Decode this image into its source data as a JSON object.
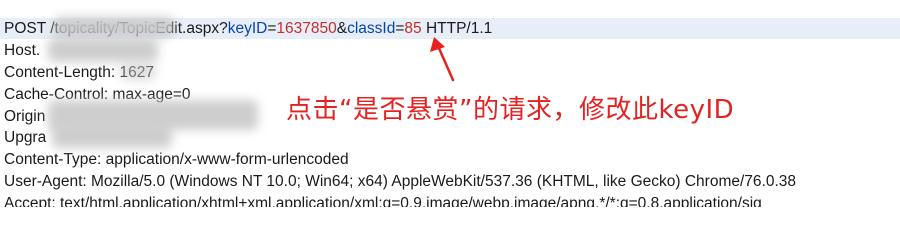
{
  "request": {
    "method": "POST",
    "path_visible": "/topicality/TopicEdit.aspx?",
    "key_param": "keyID",
    "key_eq": "=",
    "key_value": "1637850",
    "amp": "&",
    "class_param": "classId",
    "class_eq": "=",
    "class_value": "85",
    "protocol": " HTTP/1.1"
  },
  "headers": {
    "host": "Host.",
    "content_length": "Content-Length: 1627",
    "cache_control": "Cache-Control: max-age=0",
    "origin": "Origin",
    "upgrade": "Upgra",
    "content_type": "Content-Type: application/x-www-form-urlencoded",
    "user_agent": "User-Agent: Mozilla/5.0 (Windows NT 10.0; Win64; x64) AppleWebKit/537.36 (KHTML, like Gecko) Chrome/76.0.38",
    "accept": "Accept: text/html,application/xhtml+xml,application/xml;q=0.9,image/webp,image/apng,*/*;q=0.8,application/sig"
  },
  "annotation": {
    "text": "点击“是否悬赏”的请求，修改此keyID",
    "color": "#e52222"
  },
  "colors": {
    "param_name": "#0645ad",
    "param_value": "#c0312b",
    "highlight_row": "#e7eef8"
  },
  "icons": {
    "arrow": "red-pointer-arrow"
  }
}
